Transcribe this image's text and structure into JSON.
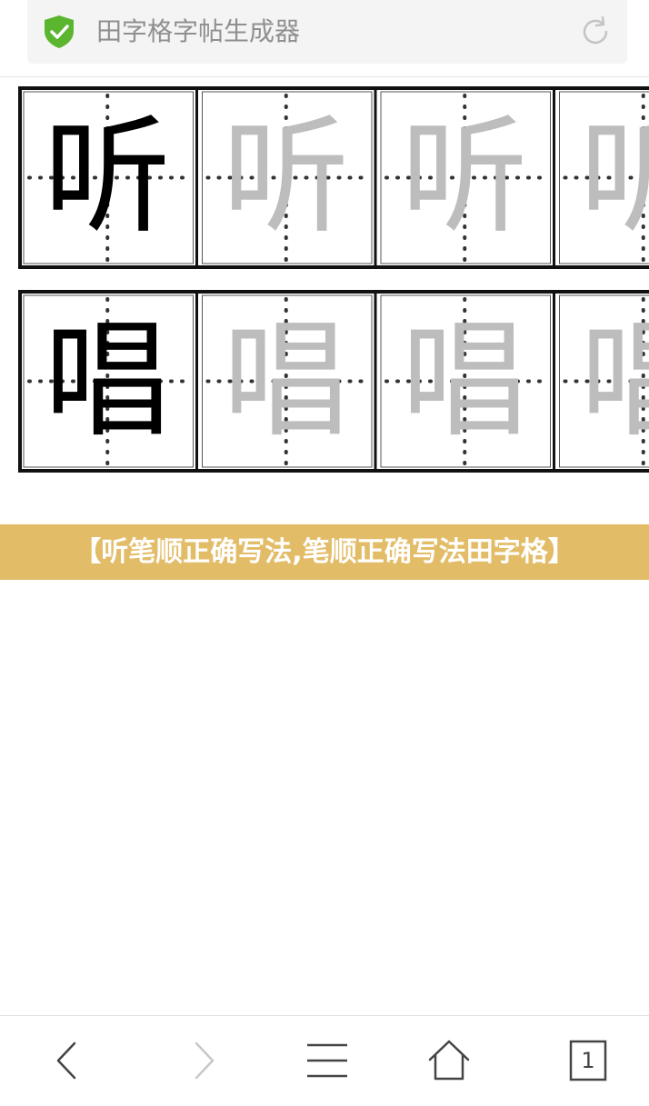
{
  "address_bar": {
    "title": "田字格字帖生成器",
    "secure_icon": "shield-check-icon",
    "reload_icon": "reload-icon",
    "secure_color": "#5bb52e"
  },
  "practice_rows": [
    {
      "character": "听",
      "cells": [
        {
          "char": "听",
          "style": "model"
        },
        {
          "char": "听",
          "style": "trace"
        },
        {
          "char": "听",
          "style": "trace"
        },
        {
          "char": "听",
          "style": "trace"
        }
      ]
    },
    {
      "character": "唱",
      "cells": [
        {
          "char": "唱",
          "style": "model"
        },
        {
          "char": "唱",
          "style": "trace"
        },
        {
          "char": "唱",
          "style": "trace"
        },
        {
          "char": "唱",
          "style": "trace"
        }
      ]
    }
  ],
  "banner": {
    "text": "【听笔顺正确写法,笔顺正确写法田字格】",
    "background": "#e3bc68"
  },
  "bottom_nav": {
    "back_icon": "chevron-left-icon",
    "forward_icon": "chevron-right-icon",
    "menu_icon": "hamburger-menu-icon",
    "home_icon": "home-icon",
    "tabs_count": "1"
  }
}
